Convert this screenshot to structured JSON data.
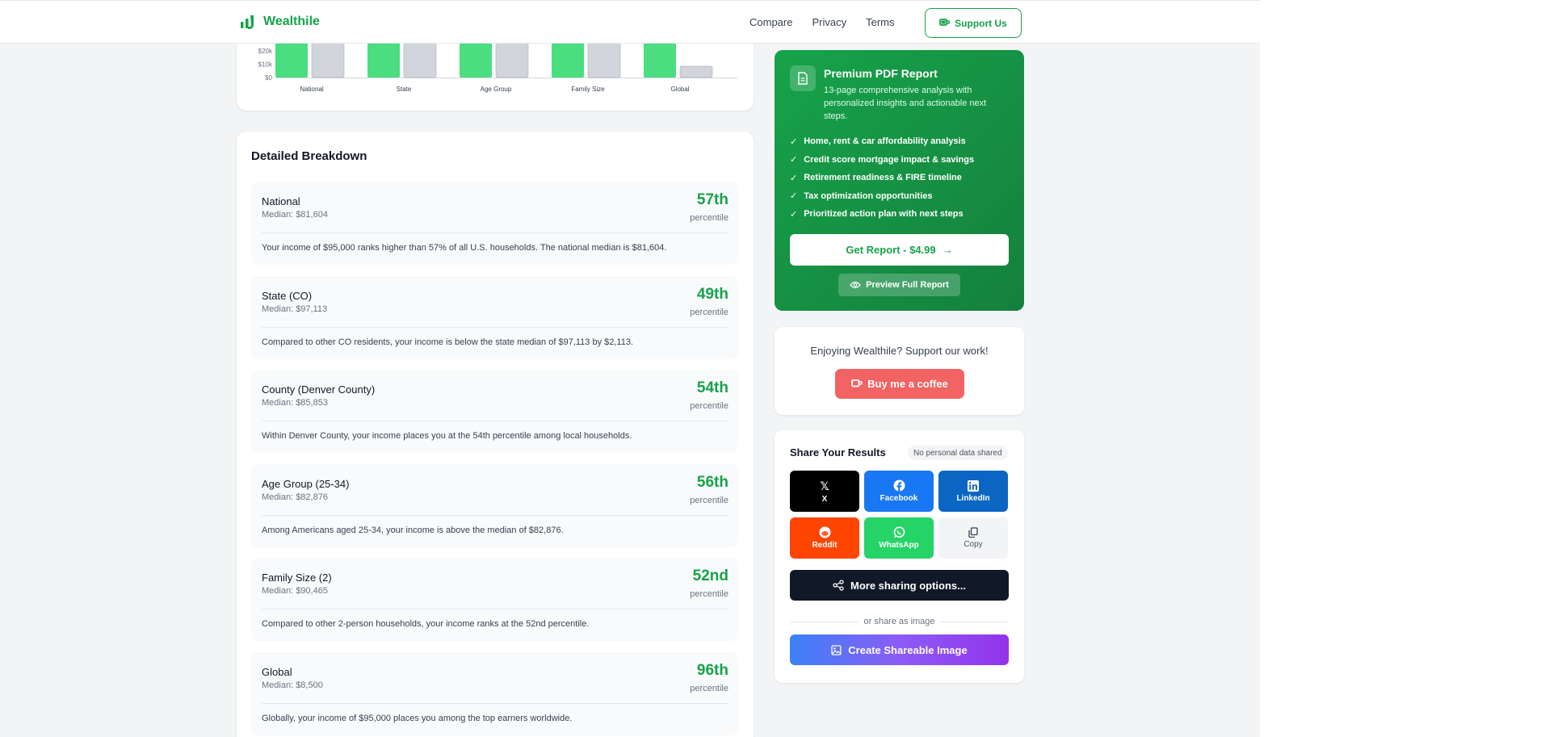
{
  "brand": {
    "name": "Wealthile"
  },
  "nav": {
    "links": [
      "Compare",
      "Privacy",
      "Terms"
    ],
    "support_label": "Support Us"
  },
  "chart_data": {
    "type": "bar",
    "categories": [
      "National",
      "State",
      "Age Group",
      "Family Size",
      "Global"
    ],
    "series": [
      {
        "color": "#4ade80",
        "values": [
          95000,
          95000,
          95000,
          95000,
          95000
        ]
      },
      {
        "color": "#d1d5db",
        "values": [
          81604,
          97113,
          82876,
          90465,
          8500
        ]
      }
    ],
    "yticks": [
      "$0",
      "$10k",
      "$20k"
    ],
    "ylim": [
      0,
      100000
    ]
  },
  "breakdown": {
    "title": "Detailed Breakdown",
    "rows": [
      {
        "name": "National",
        "median": "Median: $81,604",
        "rank": "57th",
        "pct_label": "percentile",
        "desc": "Your income of $95,000 ranks higher than 57% of all U.S. households. The national median is $81,604."
      },
      {
        "name": "State (CO)",
        "median": "Median: $97,113",
        "rank": "49th",
        "pct_label": "percentile",
        "desc": "Compared to other CO residents, your income is below the state median of $97,113 by $2,113."
      },
      {
        "name": "County (Denver County)",
        "median": "Median: $85,853",
        "rank": "54th",
        "pct_label": "percentile",
        "desc": "Within Denver County, your income places you at the 54th percentile among local households."
      },
      {
        "name": "Age Group (25-34)",
        "median": "Median: $82,876",
        "rank": "56th",
        "pct_label": "percentile",
        "desc": "Among Americans aged 25-34, your income is above the median of $82,876."
      },
      {
        "name": "Family Size (2)",
        "median": "Median: $90,465",
        "rank": "52nd",
        "pct_label": "percentile",
        "desc": "Compared to other 2-person households, your income ranks at the 52nd percentile."
      },
      {
        "name": "Global",
        "median": "Median: $8,500",
        "rank": "96th",
        "pct_label": "percentile",
        "desc": "Globally, your income of $95,000 places you among the top earners worldwide."
      }
    ]
  },
  "premium": {
    "title": "Premium PDF Report",
    "desc": "13-page comprehensive analysis with personalized insights and actionable next steps.",
    "features": [
      "Home, rent & car affordability analysis",
      "Credit score mortgage impact & savings",
      "Retirement readiness & FIRE timeline",
      "Tax optimization opportunities",
      "Prioritized action plan with next steps"
    ],
    "cta": "Get Report - $4.99",
    "preview": "Preview Full Report"
  },
  "support": {
    "text": "Enjoying Wealthile? Support our work!",
    "button": "Buy me a coffee"
  },
  "share": {
    "title": "Share Your Results",
    "badge": "No personal data shared",
    "buttons": [
      {
        "label": "X",
        "color": "#000000"
      },
      {
        "label": "Facebook",
        "color": "#1877f2"
      },
      {
        "label": "LinkedIn",
        "color": "#0a66c2"
      },
      {
        "label": "Reddit",
        "color": "#ff4500"
      },
      {
        "label": "WhatsApp",
        "color": "#25d366"
      },
      {
        "label": "Copy",
        "color": "#f3f4f6"
      }
    ],
    "more": "More sharing options...",
    "or_text": "or share as image",
    "create": "Create Shareable Image"
  }
}
